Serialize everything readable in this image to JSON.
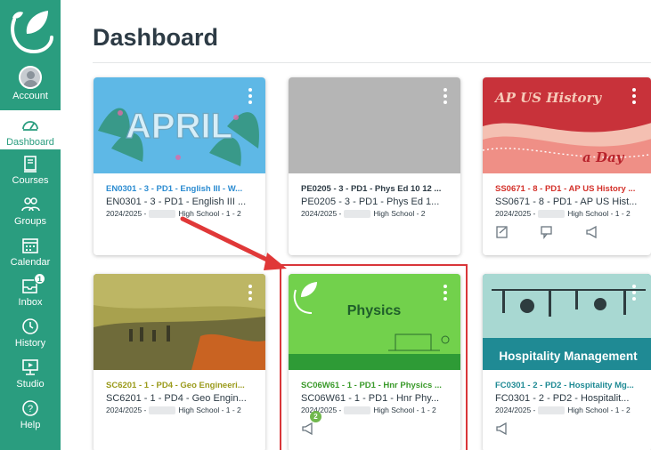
{
  "nav": {
    "items": [
      {
        "label": "Account",
        "icon": "account-avatar"
      },
      {
        "label": "Dashboard",
        "icon": "dashboard-icon"
      },
      {
        "label": "Courses",
        "icon": "courses-icon"
      },
      {
        "label": "Groups",
        "icon": "groups-icon"
      },
      {
        "label": "Calendar",
        "icon": "calendar-icon"
      },
      {
        "label": "Inbox",
        "icon": "inbox-icon",
        "badge": "1"
      },
      {
        "label": "History",
        "icon": "history-icon"
      },
      {
        "label": "Studio",
        "icon": "studio-icon"
      },
      {
        "label": "Help",
        "icon": "help-icon"
      }
    ],
    "color": "#2a9d7f"
  },
  "header": {
    "title": "Dashboard"
  },
  "cards": [
    {
      "hero_text": "APRIL",
      "short_name": "EN0301 - 3 - PD1 - English III - W...",
      "name": "EN0301 - 3 - PD1 - English III ...",
      "term": "2024/2025 -",
      "school": "High School - 1 - 2",
      "color": "#2c8cd1"
    },
    {
      "hero_text": "",
      "short_name": "PE0205 - 3 - PD1 - Phys Ed 10 12 ...",
      "name": "PE0205 - 3 - PD1 - Phys Ed 1...",
      "term": "2024/2025 -",
      "school": "High School - 2",
      "color": "#2d3b45"
    },
    {
      "hero_text": "AP US History",
      "hero_text2": "a Day",
      "short_name": "SS0671 - 8 - PD1 - AP US History ...",
      "name": "SS0671 - 8 - PD1 - AP US Hist...",
      "term": "2024/2025 -",
      "school": "High School - 1 - 2",
      "color": "#d4322b"
    },
    {
      "hero_text": "",
      "short_name": "SC6201 - 1 - PD4 - Geo Engineeri...",
      "name": "SC6201 - 1 - PD4 - Geo Engin...",
      "term": "2024/2025 -",
      "school": "High School - 1 - 2",
      "color": "#9a9a1a"
    },
    {
      "hero_text": "Physics",
      "short_name": "SC06W61 - 1 - PD1 - Hnr Physics ...",
      "name": "SC06W61 - 1 - PD1 - Hnr Phy...",
      "term": "2024/2025 -",
      "school": "High School - 1 - 2",
      "color": "#3a9a2a",
      "badge": "2"
    },
    {
      "hero_text": "Hospitality Management",
      "short_name": "FC0301 - 2 - PD2 - Hospitality Mg...",
      "name": "FC0301 - 2 - PD2 - Hospitalit...",
      "term": "2024/2025 -",
      "school": "High School - 1 - 2",
      "color": "#1f8a94"
    }
  ]
}
